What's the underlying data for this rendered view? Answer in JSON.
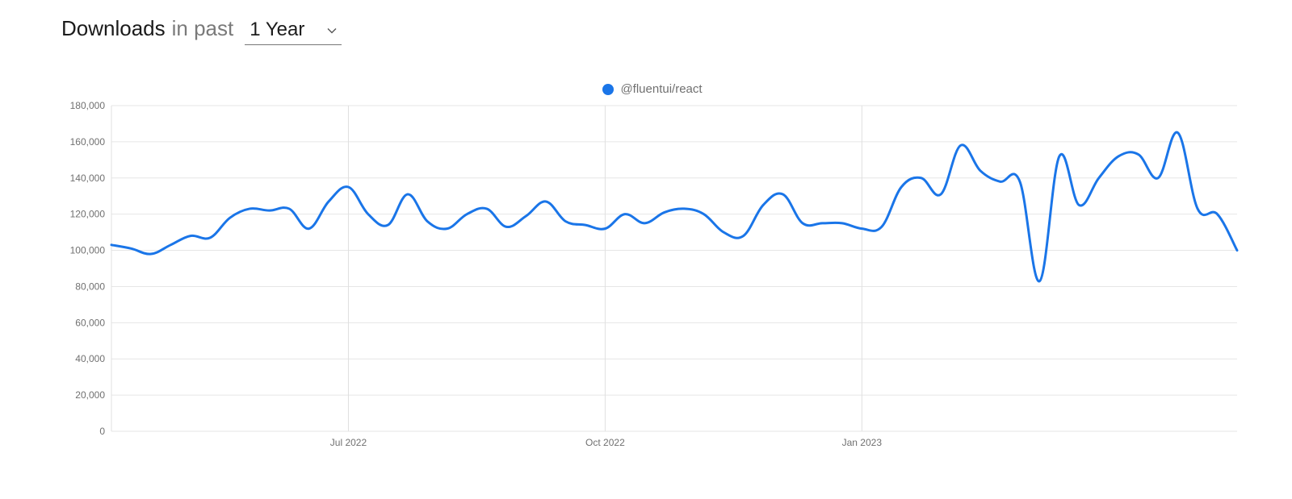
{
  "header": {
    "title_bold": "Downloads",
    "title_light": "in past",
    "dropdown_value": "1 Year"
  },
  "legend": {
    "series_name": "@fluentui/react",
    "series_color": "#1a75e8"
  },
  "chart_data": {
    "type": "line",
    "title": "",
    "xlabel": "",
    "ylabel": "",
    "ylim": [
      0,
      180000
    ],
    "y_ticks": [
      0,
      20000,
      40000,
      60000,
      80000,
      100000,
      120000,
      140000,
      160000,
      180000
    ],
    "y_tick_labels": [
      "0",
      "20,000",
      "40,000",
      "60,000",
      "80,000",
      "100,000",
      "120,000",
      "140,000",
      "160,000",
      "180,000"
    ],
    "x_ticks": [
      12,
      25,
      38
    ],
    "x_tick_labels": [
      "Jul 2022",
      "Oct 2022",
      "Jan 2023"
    ],
    "x_count": 52,
    "series": [
      {
        "name": "@fluentui/react",
        "color": "#1a75e8",
        "values": [
          103000,
          101000,
          98000,
          103000,
          108000,
          107000,
          118000,
          123000,
          122000,
          123000,
          112000,
          127000,
          135000,
          120000,
          114000,
          131000,
          116000,
          112000,
          120000,
          123000,
          113000,
          119000,
          127000,
          116000,
          114000,
          112000,
          120000,
          115000,
          121000,
          123000,
          120000,
          110000,
          108000,
          125000,
          131000,
          115000,
          115000,
          115000,
          112000,
          113000,
          135000,
          140000,
          131000,
          158000,
          144000,
          138000,
          138000,
          83000,
          152000,
          125000,
          140000,
          152000,
          153000,
          140000,
          165000,
          123000,
          120000,
          100000
        ]
      }
    ]
  }
}
